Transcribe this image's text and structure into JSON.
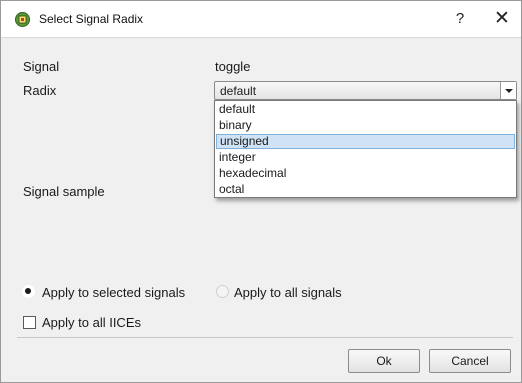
{
  "window": {
    "title": "Select Signal Radix",
    "help_label": "?",
    "close_label": "✕",
    "app_icon": "chip-icon"
  },
  "form": {
    "signal_label": "Signal",
    "signal_value": "toggle",
    "radix_label": "Radix",
    "radix_selected": "default",
    "signal_sample_label": "Signal sample"
  },
  "dropdown": {
    "options": [
      "default",
      "binary",
      "unsigned",
      "integer",
      "hexadecimal",
      "octal"
    ],
    "highlighted": "unsigned"
  },
  "apply": {
    "selected_signals_label": "Apply to selected signals",
    "all_signals_label": "Apply to all signals",
    "selected_signals_checked": true,
    "all_signals_checked": false,
    "all_ices_label": "Apply to all IICEs",
    "all_ices_checked": false
  },
  "buttons": {
    "ok_label": "Ok",
    "cancel_label": "Cancel"
  }
}
